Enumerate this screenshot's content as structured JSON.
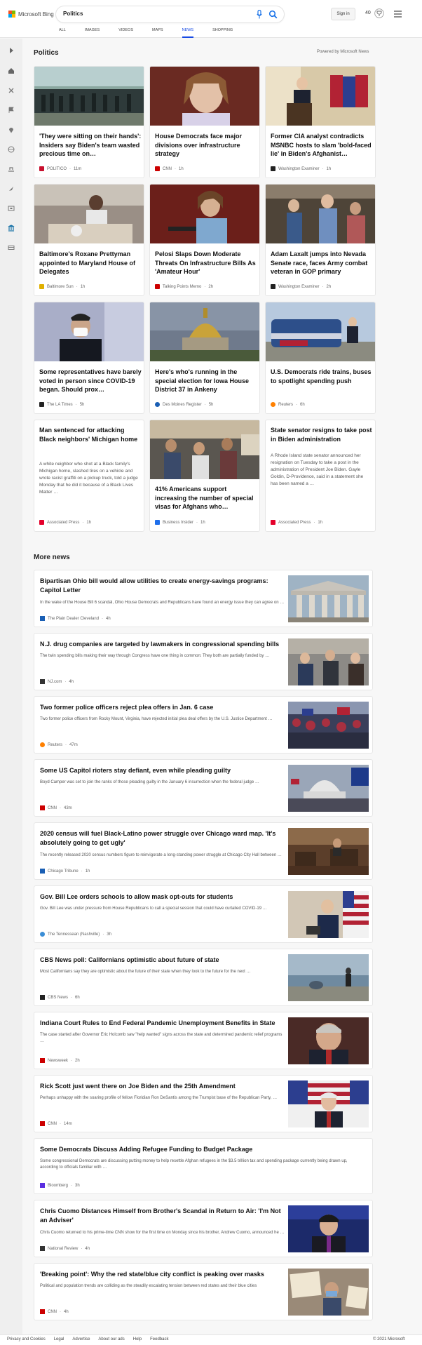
{
  "header": {
    "brand": "Microsoft Bing",
    "query": "Politics",
    "sign_in": "Sign in",
    "rewards_points": "40",
    "tabs": [
      "ALL",
      "IMAGES",
      "VIDEOS",
      "MAPS",
      "NEWS",
      "SHOPPING"
    ],
    "active_tab": "NEWS"
  },
  "politics": {
    "title": "Politics",
    "powered_by": "Powered by Microsoft News",
    "cards": [
      {
        "title": "'They were sitting on their hands': Insiders say Biden's team wasted precious time on…",
        "source": "POLITICO",
        "time": "11m",
        "logo_color": "#c8102e"
      },
      {
        "title": "House Democrats face major divisions over infrastructure strategy",
        "source": "CNN",
        "time": "1h",
        "logo_color": "#cc0000"
      },
      {
        "title": "Former CIA analyst contradicts MSNBC hosts to slam 'bold-faced lie' in Biden's Afghanist…",
        "source": "Washington Examiner",
        "time": "1h",
        "logo_color": "#222222"
      },
      {
        "title": "Baltimore's Roxane Prettyman appointed to Maryland House of Delegates",
        "source": "Baltimore Sun",
        "time": "1h",
        "logo_color": "#e0b000"
      },
      {
        "title": "Pelosi Slaps Down Moderate Threats On Infrastructure Bills As 'Amateur Hour'",
        "source": "Talking Points Memo",
        "time": "2h",
        "logo_color": "#cc0000"
      },
      {
        "title": "Adam Laxalt jumps into Nevada Senate race, faces Army combat veteran in GOP primary",
        "source": "Washington Examiner",
        "time": "2h",
        "logo_color": "#222222"
      },
      {
        "title": "Some representatives have barely voted in person since COVID-19 began. Should prox…",
        "source": "The LA Times",
        "time": "5h",
        "logo_color": "#222222"
      },
      {
        "title": "Here's who's running in the special election for Iowa House District 37 in Ankeny",
        "source": "Des Moines Register",
        "time": "5h",
        "logo_color": "#1a5fb4"
      },
      {
        "title": "U.S. Democrats ride trains, buses to spotlight spending push",
        "source": "Reuters",
        "time": "6h",
        "logo_color": "#ff8000"
      },
      {
        "title": "Man sentenced for attacking Black neighbors' Michigan home",
        "snippet": "A white neighbor who shot at a Black family's Michigan home, slashed tires on a vehicle and wrote racist graffiti on a pickup truck, told a judge Monday that he did it because of a Black Lives Matter …",
        "source": "Associated Press",
        "time": "1h",
        "logo_color": "#e4002b"
      },
      {
        "title": "41% Americans support increasing the number of special visas for Afghans who…",
        "source": "Business Insider",
        "time": "1h",
        "logo_color": "#1f6feb"
      },
      {
        "title": "State senator resigns to take post in Biden administration",
        "snippet": "A Rhode Island state senator announced her resignation on Tuesday to take a post in the administration of President Joe Biden. Gayle Goldin, D-Providence, said in a statement she has been named a …",
        "source": "Associated Press",
        "time": "1h",
        "logo_color": "#e4002b"
      }
    ]
  },
  "more_news": {
    "title": "More news",
    "items": [
      {
        "title": "Bipartisan Ohio bill would allow utilities to create energy-savings programs: Capitol Letter",
        "snippet": "In the wake of the House Bill 6 scandal, Ohio House Democrats and Republicans have found an energy issue they can agree on …",
        "source": "The Plain Dealer Cleveland",
        "time": "4h",
        "logo_color": "#1a5fb4"
      },
      {
        "title": "N.J. drug companies are targeted by lawmakers in congressional spending bills",
        "snippet": "The twin spending bills making their way through Congress have one thing in common: They both are partially funded by …",
        "source": "NJ.com",
        "time": "4h",
        "logo_color": "#333333"
      },
      {
        "title": "Two former police officers reject plea offers in Jan. 6 case",
        "snippet": "Two former police officers from Rocky Mount, Virginia, have rejected initial plea deal offers by the U.S. Justice Department …",
        "source": "Reuters",
        "time": "47m",
        "logo_color": "#ff8000"
      },
      {
        "title": "Some US Capitol rioters stay defiant, even while pleading guilty",
        "snippet": "Boyd Camper was set to join the ranks of those pleading guilty in the January 6 insurrection when the federal judge …",
        "source": "CNN",
        "time": "43m",
        "logo_color": "#cc0000"
      },
      {
        "title": "2020 census will fuel Black-Latino power struggle over Chicago ward map. 'It's absolutely going to get ugly'",
        "snippet": "The recently released 2020 census numbers figure to reinvigorate a long-standing power struggle at Chicago City Hall between …",
        "source": "Chicago Tribune",
        "time": "1h",
        "logo_color": "#1a5fb4"
      },
      {
        "title": "Gov. Bill Lee orders schools to allow mask opt-outs for students",
        "snippet": "Gov. Bill Lee was under pressure from House Republicans to call a special session that could have curtailed COVID-19 …",
        "source": "The Tennessean (Nashville)",
        "time": "3h",
        "logo_color": "#3b8ed6"
      },
      {
        "title": "CBS News poll: Californians optimistic about future of state",
        "snippet": "Most Californians say they are optimistic about the future of their state when they look to the future for the next …",
        "source": "CBS News",
        "time": "6h",
        "logo_color": "#222222"
      },
      {
        "title": "Indiana Court Rules to End Federal Pandemic Unemployment Benefits in State",
        "snippet": "The case started after Governor Eric Holcomb saw \"help wanted\" signs across the state and determined pandemic relief programs …",
        "source": "Newsweek",
        "time": "2h",
        "logo_color": "#cc0000"
      },
      {
        "title": "Rick Scott just went there on Joe Biden and the 25th Amendment",
        "snippet": "Perhaps unhappy with the soaring profile of fellow Floridian Ron DeSantis among the Trumpist base of the Republican Party, …",
        "source": "CNN",
        "time": "14m",
        "logo_color": "#cc0000"
      },
      {
        "title": "Some Democrats Discuss Adding Refugee Funding to Budget Package",
        "snippet": "Some congressional Democrats are discussing putting money to help resettle Afghan refugees in the $3.5 trillion tax and spending package currently being drawn up, according to officials familiar with …",
        "source": "Bloomberg",
        "time": "3h",
        "logo_color": "#5a2ee0"
      },
      {
        "title": "Chris Cuomo Distances Himself from Brother's Scandal in Return to Air: 'I'm Not an Adviser'",
        "snippet": "Chris Cuomo returned to his prime-time CNN show for the first time on Monday since his brother, Andrew Cuomo, announced he …",
        "source": "National Review",
        "time": "4h",
        "logo_color": "#333333"
      },
      {
        "title": "'Breaking point': Why the red state/blue city conflict is peaking over masks",
        "snippet": "Political and population trends are colliding as the steadily escalating tension between red states and their blue cities",
        "source": "CNN",
        "time": "4h",
        "logo_color": "#cc0000"
      }
    ]
  },
  "footer": {
    "links": [
      "Privacy and Cookies",
      "Legal",
      "Advertise",
      "About our ads",
      "Help",
      "Feedback"
    ],
    "copyright": "© 2021 Microsoft"
  }
}
